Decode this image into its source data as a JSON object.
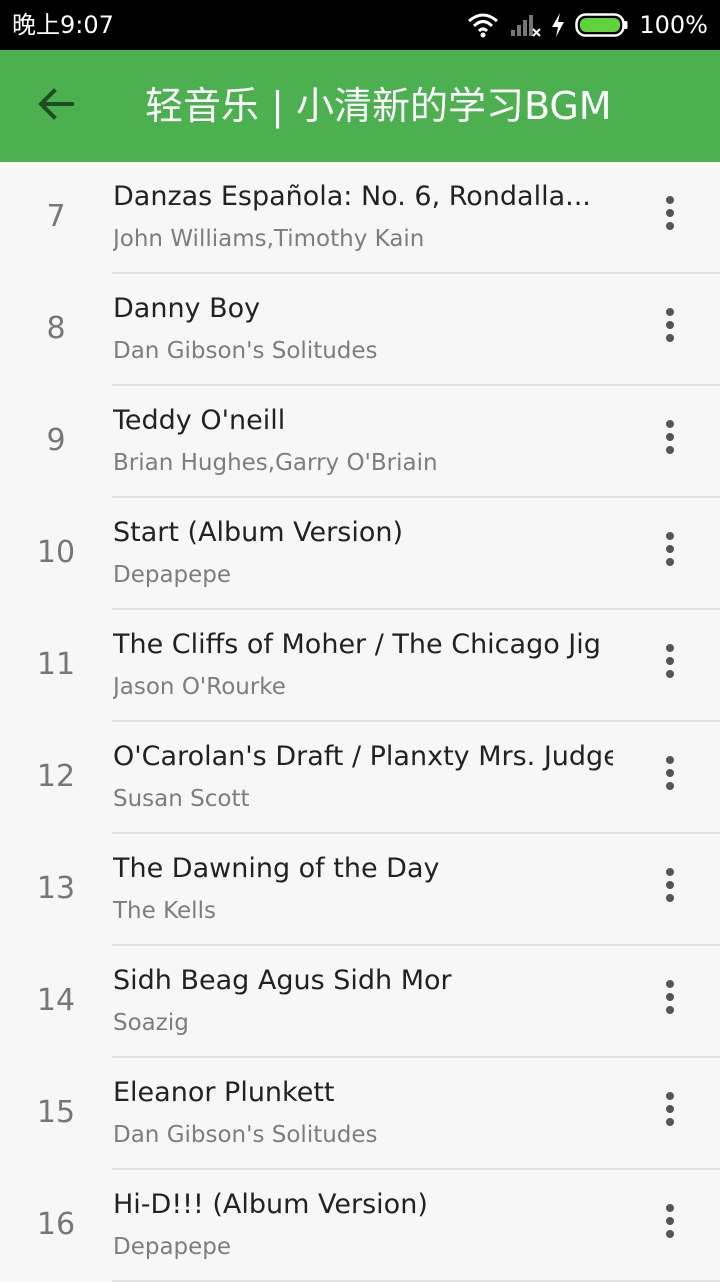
{
  "status_bar": {
    "time": "晚上9:07",
    "battery": "100%"
  },
  "app_bar": {
    "title": "轻音乐 | 小清新的学习BGM"
  },
  "songs": [
    {
      "index": "7",
      "title": "Danzas Española: No. 6, Rondalla...",
      "artist": "John Williams,Timothy Kain"
    },
    {
      "index": "8",
      "title": "Danny Boy",
      "artist": "Dan Gibson's Solitudes"
    },
    {
      "index": "9",
      "title": "Teddy O'neill",
      "artist": "Brian Hughes,Garry O'Briain"
    },
    {
      "index": "10",
      "title": "Start (Album Version)",
      "artist": "Depapepe"
    },
    {
      "index": "11",
      "title": "The Cliffs of Moher / The Chicago Jig",
      "artist": "Jason O'Rourke"
    },
    {
      "index": "12",
      "title": "O'Carolan's Draft / Planxty Mrs. Judge",
      "artist": "Susan Scott"
    },
    {
      "index": "13",
      "title": "The Dawning of the Day",
      "artist": "The Kells"
    },
    {
      "index": "14",
      "title": "Sidh Beag Agus Sidh Mor",
      "artist": "Soazig"
    },
    {
      "index": "15",
      "title": "Eleanor Plunkett",
      "artist": "Dan Gibson's Solitudes"
    },
    {
      "index": "16",
      "title": "Hi-D!!! (Album Version)",
      "artist": "Depapepe"
    }
  ],
  "colors": {
    "app_bar": "#4caf50",
    "status_bar": "#000000",
    "battery_fill": "#5fd23c"
  },
  "icons": {
    "back": "arrow-left-icon",
    "more": "more-vertical-icon",
    "wifi": "wifi-icon",
    "signal": "signal-icon",
    "charging": "charging-bolt-icon",
    "battery": "battery-icon"
  }
}
